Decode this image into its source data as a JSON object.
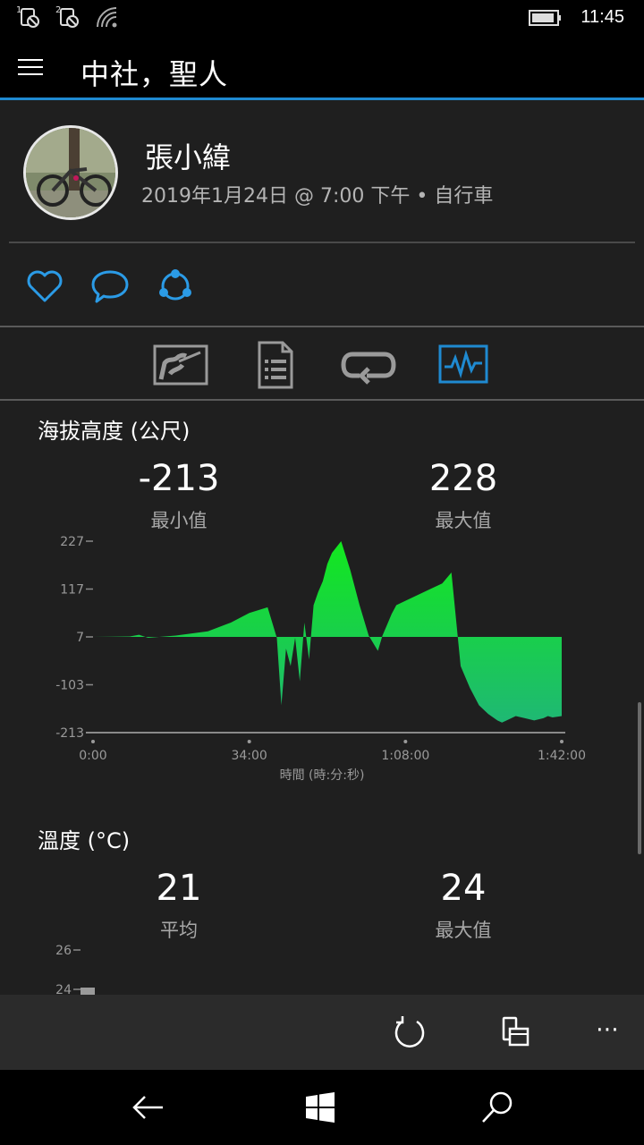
{
  "status_bar": {
    "sim1": "1",
    "sim2": "2",
    "time": "11:45"
  },
  "title_bar": {
    "title": "中社，聖人"
  },
  "activity": {
    "user_name": "張小緯",
    "meta": "2019年1月24日 @ 7:00 下午 • 自行車"
  },
  "elevation": {
    "title": "海拔高度 (公尺)",
    "min_value": "-213",
    "min_label": "最小值",
    "max_value": "228",
    "max_label": "最大值"
  },
  "temperature": {
    "title": "溫度 (°C)",
    "avg_value": "21",
    "avg_label": "平均",
    "max_value": "24",
    "max_label": "最大值"
  },
  "colors": {
    "accent": "#1f8ad1",
    "chart_green_top": "#12e81e",
    "chart_green_bottom": "#1fb874",
    "temp_bar": "#9a9a9a"
  },
  "chart_data": [
    {
      "type": "area",
      "title": "",
      "xlabel": "時間 (時:分:秒)",
      "ylabel": "",
      "x_ticks": [
        "0:00",
        "34:00",
        "1:08:00",
        "1:42:00"
      ],
      "y_ticks": [
        "227",
        "117",
        "7",
        "-103",
        "-213"
      ],
      "ylim": [
        -213,
        227
      ],
      "xlim_minutes": [
        0,
        102
      ],
      "x_minutes": [
        0,
        8,
        10,
        12,
        18,
        25,
        30,
        34,
        38,
        40,
        41,
        42,
        43,
        44,
        45,
        46,
        47,
        48,
        49,
        50,
        51,
        52,
        54,
        56,
        58,
        60,
        62,
        63,
        64,
        65,
        66,
        68,
        70,
        72,
        74,
        76,
        78,
        80,
        82,
        84,
        86,
        88,
        89,
        90,
        92,
        94,
        96,
        98,
        99,
        100,
        102
      ],
      "y": [
        7,
        8,
        12,
        5,
        10,
        20,
        40,
        62,
        75,
        5,
        -150,
        -20,
        -60,
        5,
        -95,
        40,
        -45,
        80,
        110,
        135,
        175,
        200,
        227,
        160,
        80,
        10,
        -25,
        10,
        35,
        60,
        80,
        90,
        100,
        110,
        120,
        130,
        155,
        -60,
        -110,
        -150,
        -170,
        -185,
        -190,
        -185,
        -175,
        -180,
        -185,
        -180,
        -175,
        -178,
        -175
      ]
    },
    {
      "type": "bar",
      "title": "",
      "xlabel": "",
      "ylabel": "",
      "y_ticks": [
        "26",
        "24"
      ],
      "values": [
        24
      ]
    }
  ]
}
